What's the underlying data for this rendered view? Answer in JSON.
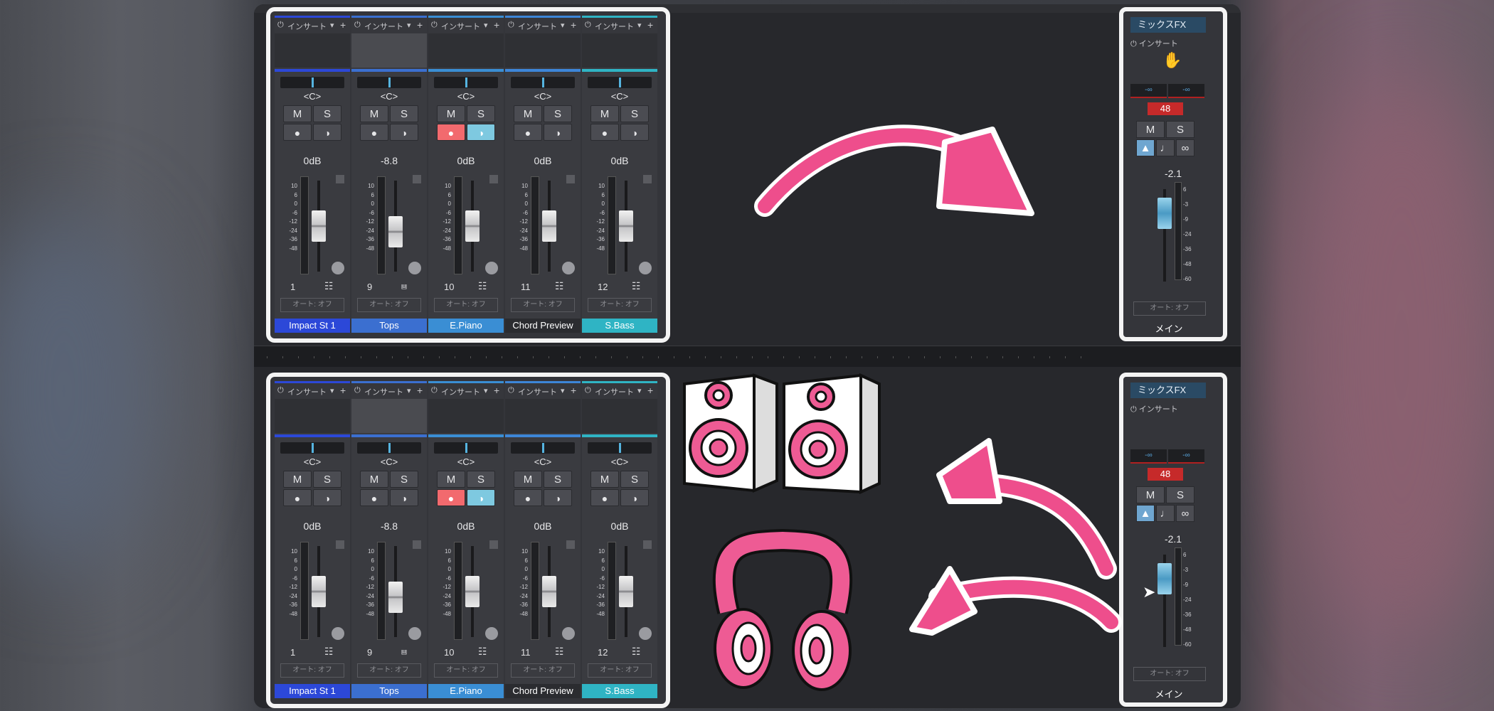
{
  "channels": [
    {
      "insert": "インサート",
      "pan": "<C>",
      "mute": "M",
      "solo": "S",
      "db": "0dB",
      "number": "1",
      "auto": "オート: オフ",
      "name": "Impact St 1",
      "color": "#2c48d8",
      "recording": false,
      "selected": false,
      "fader_level": 0.5
    },
    {
      "insert": "インサート",
      "pan": "<C>",
      "mute": "M",
      "solo": "S",
      "db": "-8.8",
      "number": "9",
      "auto": "オート: オフ",
      "name": "Tops",
      "color": "#3b6fd0",
      "recording": false,
      "selected": true,
      "fader_level": 0.4
    },
    {
      "insert": "インサート",
      "pan": "<C>",
      "mute": "M",
      "solo": "S",
      "db": "0dB",
      "number": "10",
      "auto": "オート: オフ",
      "name": "E.Piano",
      "color": "#3a8ed4",
      "recording": true,
      "selected": false,
      "fader_level": 0.5
    },
    {
      "insert": "インサート",
      "pan": "<C>",
      "mute": "M",
      "solo": "S",
      "db": "0dB",
      "number": "11",
      "auto": "オート: オフ",
      "name": "Chord Preview",
      "color": "#2b2c30",
      "recording": false,
      "selected": false,
      "fader_level": 0.5
    },
    {
      "insert": "インサート",
      "pan": "<C>",
      "mute": "M",
      "solo": "S",
      "db": "0dB",
      "number": "12",
      "auto": "オート: オフ",
      "name": "S.Bass",
      "color": "#2fb4c4",
      "recording": false,
      "selected": false,
      "fader_level": 0.5
    }
  ],
  "channel_scale": [
    "10",
    "6",
    "0",
    "-6",
    "-12",
    "-24",
    "-36",
    "-48"
  ],
  "master": {
    "fx_label": "ミックスFX",
    "insert": "インサート",
    "inf_left": "-∞",
    "inf_right": "-∞",
    "bpm": "48",
    "mute": "M",
    "solo": "S",
    "db": "-2.1",
    "scale": [
      "6",
      "-3",
      "-9",
      "-24",
      "-36",
      "-48",
      "-60"
    ],
    "auto": "オート: オフ",
    "name": "メイン"
  },
  "colors": {
    "arrow": "#ee4e8c",
    "accent_blue": "#3d86d8"
  }
}
